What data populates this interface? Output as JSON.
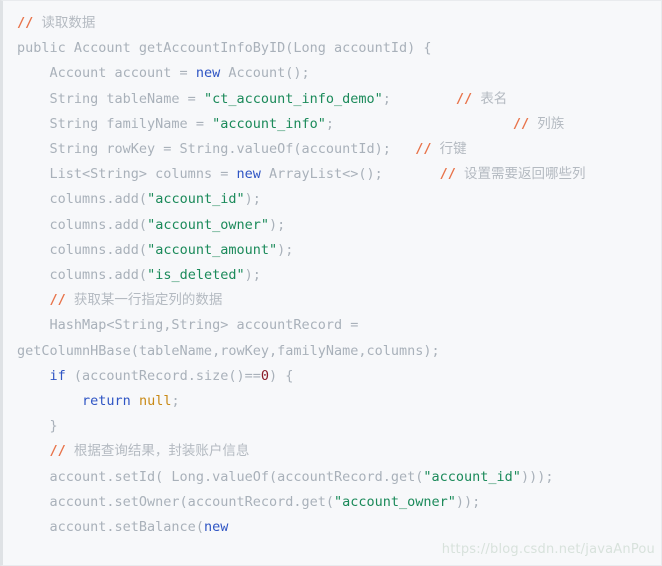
{
  "editor": {
    "background_color": "#f7f8fa",
    "border_color": "#dfe2e5",
    "language": "java",
    "colors": {
      "plain": "#a9b1ba",
      "keyword": "#2f55c4",
      "string": "#1b8a5a",
      "number": "#8a1b28",
      "null_literal": "#c98a16",
      "comment_marker": "#e8734a",
      "comment_text": "#b4bac1",
      "watermark": "#d8e2dc"
    }
  },
  "watermark": {
    "text": "https://blog.csdn.net/javaAnPou"
  },
  "code": {
    "lines": [
      {
        "id": "line-1",
        "segments": [
          {
            "type": "comment_marker",
            "text": "// "
          },
          {
            "type": "comment_text",
            "text": "读取数据"
          }
        ]
      },
      {
        "id": "line-2",
        "segments": [
          {
            "type": "plain",
            "text": "public Account getAccountInfoByID(Long accountId) {"
          }
        ]
      },
      {
        "id": "line-3",
        "segments": [
          {
            "type": "plain",
            "text": "    Account account = "
          },
          {
            "type": "keyword",
            "text": "new"
          },
          {
            "type": "plain",
            "text": " Account();"
          }
        ]
      },
      {
        "id": "line-4",
        "segments": [
          {
            "type": "plain",
            "text": "    String tableName = "
          },
          {
            "type": "string",
            "text": "\"ct_account_info_demo\""
          },
          {
            "type": "plain",
            "text": ";        "
          },
          {
            "type": "comment_marker",
            "text": "// "
          },
          {
            "type": "comment_text",
            "text": "表名"
          }
        ]
      },
      {
        "id": "line-5",
        "segments": [
          {
            "type": "plain",
            "text": "    String familyName = "
          },
          {
            "type": "string",
            "text": "\"account_info\""
          },
          {
            "type": "plain",
            "text": ";                      "
          },
          {
            "type": "comment_marker",
            "text": "// "
          },
          {
            "type": "comment_text",
            "text": "列族"
          }
        ]
      },
      {
        "id": "line-6",
        "segments": [
          {
            "type": "plain",
            "text": "    String rowKey = String.valueOf(accountId);   "
          },
          {
            "type": "comment_marker",
            "text": "// "
          },
          {
            "type": "comment_text",
            "text": "行键"
          }
        ]
      },
      {
        "id": "line-7",
        "segments": [
          {
            "type": "plain",
            "text": "    List<String> columns = "
          },
          {
            "type": "keyword",
            "text": "new"
          },
          {
            "type": "plain",
            "text": " ArrayList<>();       "
          },
          {
            "type": "comment_marker",
            "text": "// "
          },
          {
            "type": "comment_text",
            "text": "设置需要返回哪些列"
          }
        ]
      },
      {
        "id": "line-8",
        "segments": [
          {
            "type": "plain",
            "text": "    columns.add("
          },
          {
            "type": "string",
            "text": "\"account_id\""
          },
          {
            "type": "plain",
            "text": ");"
          }
        ]
      },
      {
        "id": "line-9",
        "segments": [
          {
            "type": "plain",
            "text": "    columns.add("
          },
          {
            "type": "string",
            "text": "\"account_owner\""
          },
          {
            "type": "plain",
            "text": ");"
          }
        ]
      },
      {
        "id": "line-10",
        "segments": [
          {
            "type": "plain",
            "text": "    columns.add("
          },
          {
            "type": "string",
            "text": "\"account_amount\""
          },
          {
            "type": "plain",
            "text": ");"
          }
        ]
      },
      {
        "id": "line-11",
        "segments": [
          {
            "type": "plain",
            "text": "    columns.add("
          },
          {
            "type": "string",
            "text": "\"is_deleted\""
          },
          {
            "type": "plain",
            "text": ");"
          }
        ]
      },
      {
        "id": "line-12",
        "segments": [
          {
            "type": "plain",
            "text": "    "
          },
          {
            "type": "comment_marker",
            "text": "// "
          },
          {
            "type": "comment_text",
            "text": "获取某一行指定列的数据"
          }
        ]
      },
      {
        "id": "line-13",
        "segments": [
          {
            "type": "plain",
            "text": "    HashMap<String,String> accountRecord = getColumnHBase(tableName,rowKey,familyName,columns);"
          }
        ]
      },
      {
        "id": "line-14",
        "segments": [
          {
            "type": "plain",
            "text": "    "
          },
          {
            "type": "keyword",
            "text": "if"
          },
          {
            "type": "plain",
            "text": " (accountRecord.size()=="
          },
          {
            "type": "number",
            "text": "0"
          },
          {
            "type": "plain",
            "text": ") {"
          }
        ]
      },
      {
        "id": "line-15",
        "segments": [
          {
            "type": "plain",
            "text": "        "
          },
          {
            "type": "keyword",
            "text": "return"
          },
          {
            "type": "plain",
            "text": " "
          },
          {
            "type": "null_literal",
            "text": "null"
          },
          {
            "type": "plain",
            "text": ";"
          }
        ]
      },
      {
        "id": "line-16",
        "segments": [
          {
            "type": "plain",
            "text": "    }"
          }
        ]
      },
      {
        "id": "line-17",
        "segments": [
          {
            "type": "plain",
            "text": "    "
          },
          {
            "type": "comment_marker",
            "text": "// "
          },
          {
            "type": "comment_text",
            "text": "根据查询结果，封装账户信息"
          }
        ]
      },
      {
        "id": "line-18",
        "segments": [
          {
            "type": "plain",
            "text": "    account.setId( Long.valueOf(accountRecord.get("
          },
          {
            "type": "string",
            "text": "\"account_id\""
          },
          {
            "type": "plain",
            "text": ")));"
          }
        ]
      },
      {
        "id": "line-19",
        "segments": [
          {
            "type": "plain",
            "text": "    account.setOwner(accountRecord.get("
          },
          {
            "type": "string",
            "text": "\"account_owner\""
          },
          {
            "type": "plain",
            "text": "));"
          }
        ]
      },
      {
        "id": "line-20",
        "segments": [
          {
            "type": "plain",
            "text": "    account.setBalance("
          },
          {
            "type": "keyword",
            "text": "new"
          },
          {
            "type": "plain",
            "text": " "
          }
        ]
      }
    ]
  }
}
